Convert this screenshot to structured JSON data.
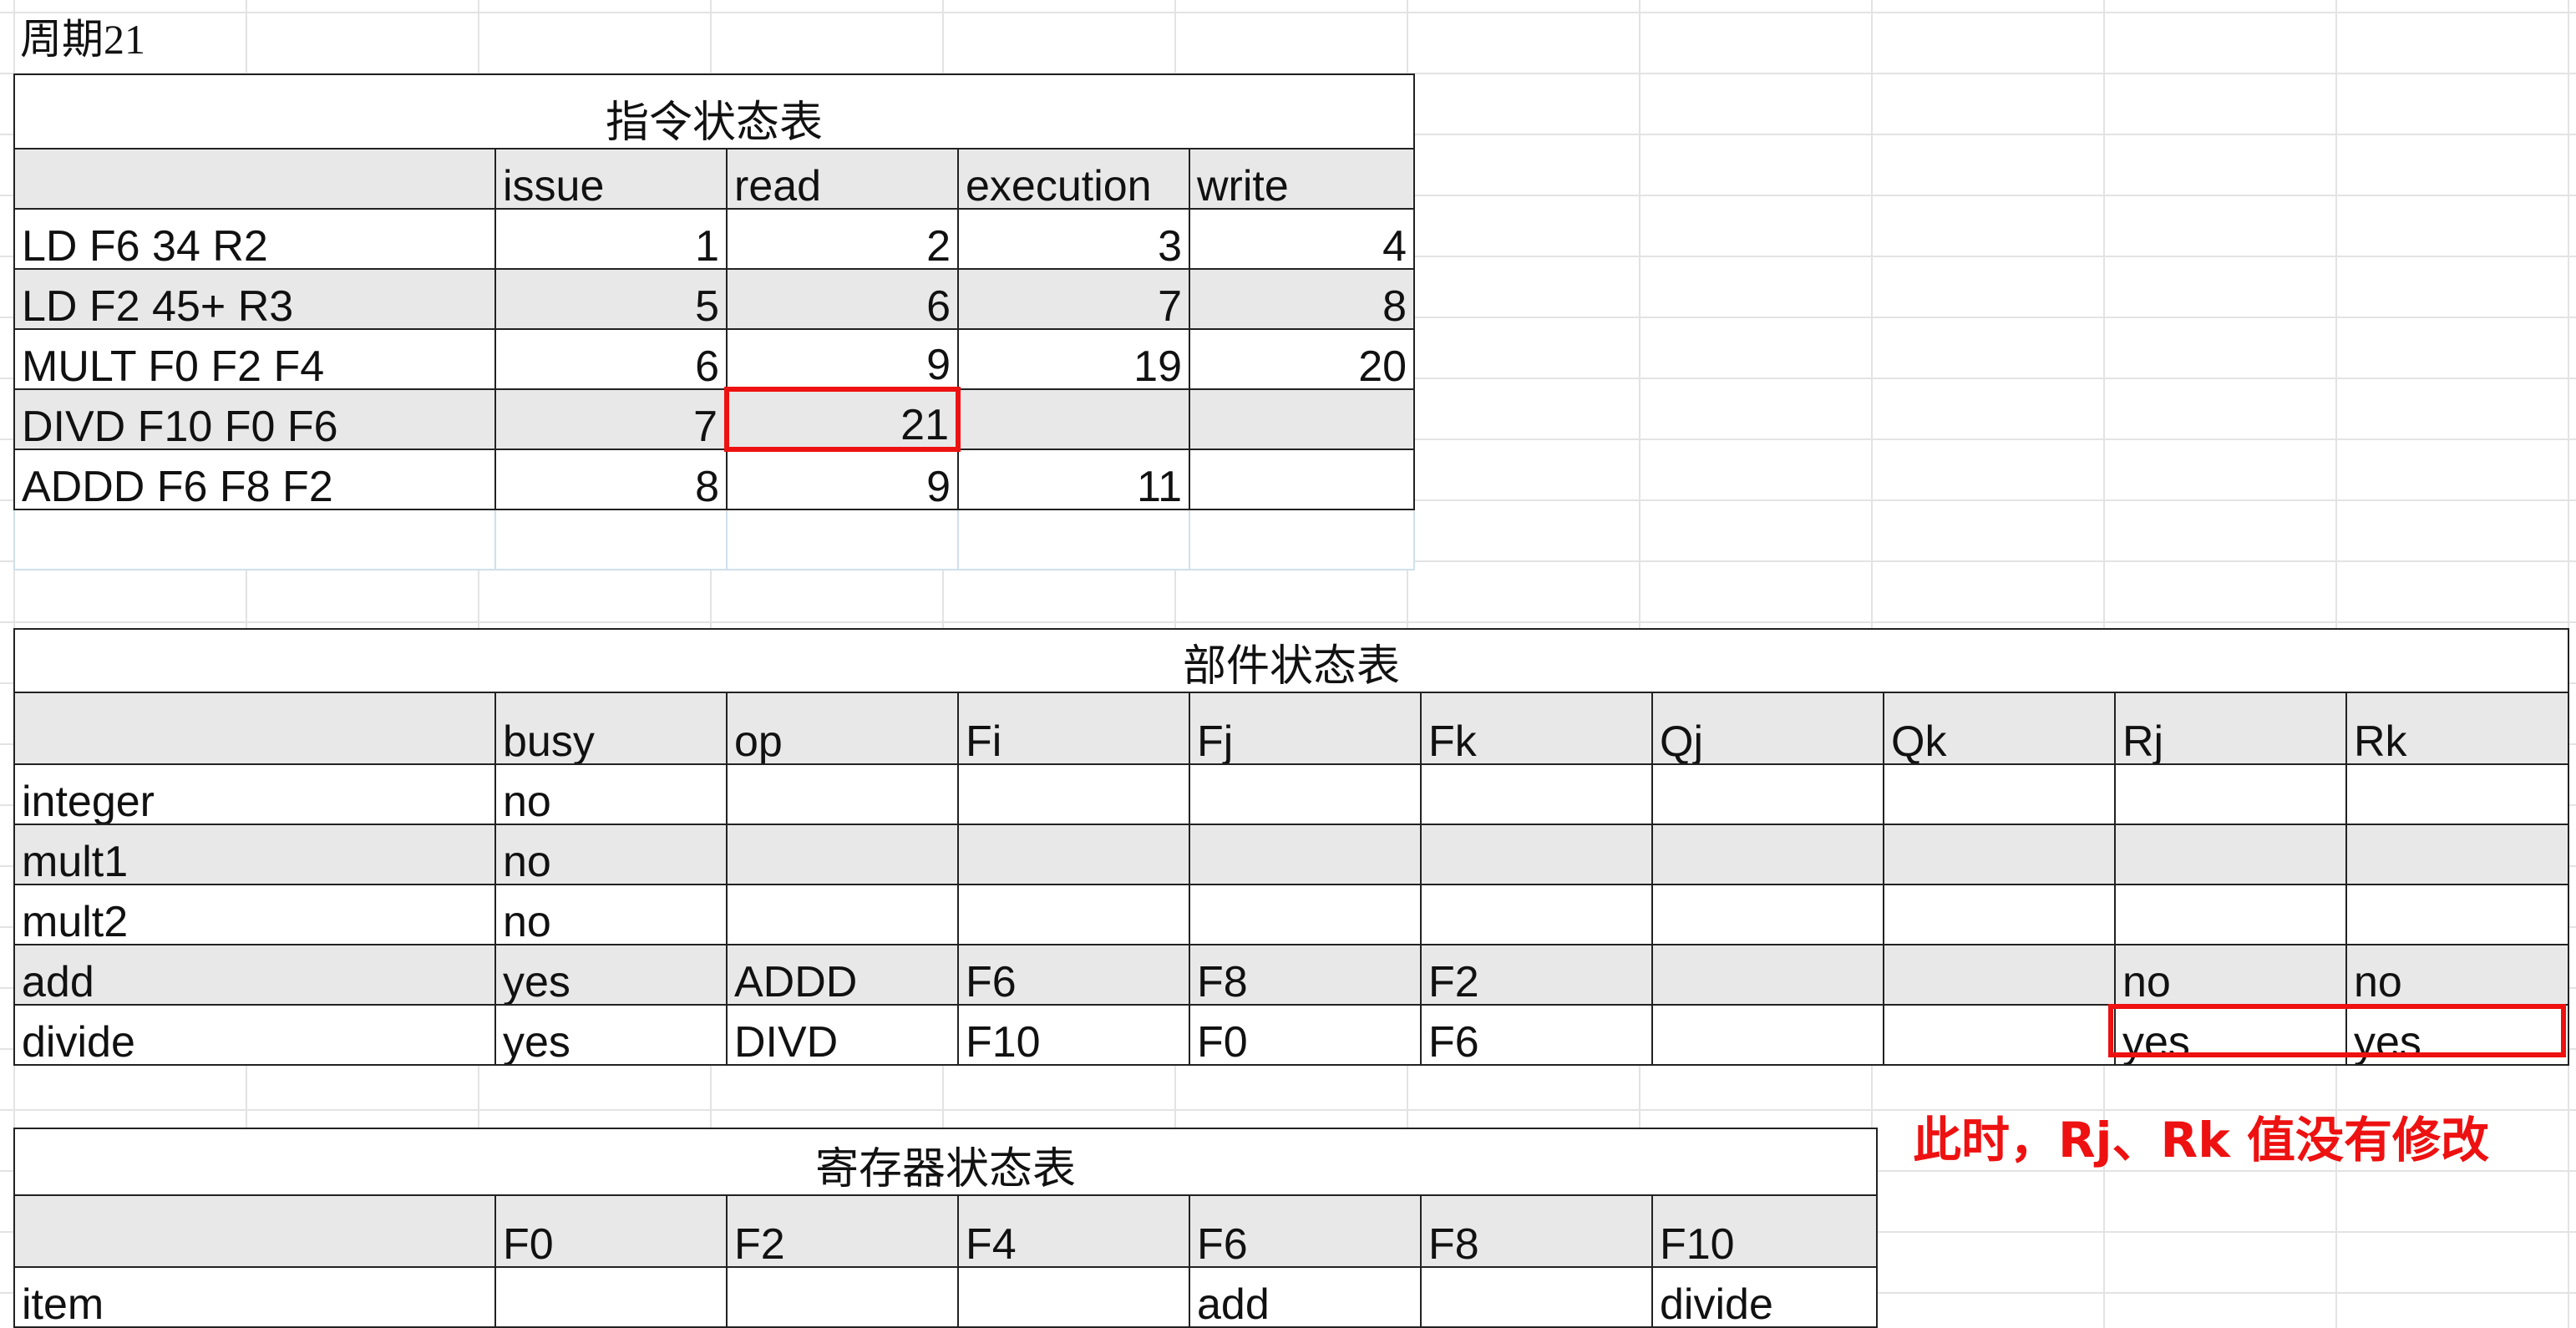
{
  "cycle_label": "周期21",
  "instruction_table": {
    "title": "指令状态表",
    "headers": [
      "",
      "issue",
      "read",
      "execution",
      "write"
    ],
    "rows": [
      [
        "LD F6 34 R2",
        "1",
        "2",
        "3",
        "4"
      ],
      [
        "LD F2 45+ R3",
        "5",
        "6",
        "7",
        "8"
      ],
      [
        "MULT F0 F2 F4",
        "6",
        "9",
        "19",
        "20"
      ],
      [
        "DIVD F10 F0 F6",
        "7",
        "21",
        "",
        ""
      ],
      [
        "ADDD F6 F8 F2",
        "8",
        "9",
        "11",
        ""
      ]
    ]
  },
  "unit_table": {
    "title": "部件状态表",
    "headers": [
      "",
      "busy",
      "op",
      "Fi",
      "Fj",
      "Fk",
      "Qj",
      "Qk",
      "Rj",
      "Rk"
    ],
    "rows": [
      [
        "integer",
        "no",
        "",
        "",
        "",
        "",
        "",
        "",
        "",
        ""
      ],
      [
        "mult1",
        "no",
        "",
        "",
        "",
        "",
        "",
        "",
        "",
        ""
      ],
      [
        "mult2",
        "no",
        "",
        "",
        "",
        "",
        "",
        "",
        "",
        ""
      ],
      [
        "add",
        "yes",
        "ADDD",
        "F6",
        "F8",
        "F2",
        "",
        "",
        "no",
        "no"
      ],
      [
        "divide",
        "yes",
        "DIVD",
        "F10",
        "F0",
        "F6",
        "",
        "",
        "yes",
        "yes"
      ]
    ]
  },
  "register_table": {
    "title": "寄存器状态表",
    "headers": [
      "",
      "F0",
      "F2",
      "F4",
      "F6",
      "F8",
      "F10"
    ],
    "rows": [
      [
        "item",
        "",
        "",
        "",
        "add",
        "",
        "divide"
      ]
    ]
  },
  "annotation": "此时，Rj、Rk 值没有修改",
  "colors": {
    "highlight": "#ee1111",
    "header_fill": "#e8e8e8",
    "grid": "#e3e3e3"
  }
}
